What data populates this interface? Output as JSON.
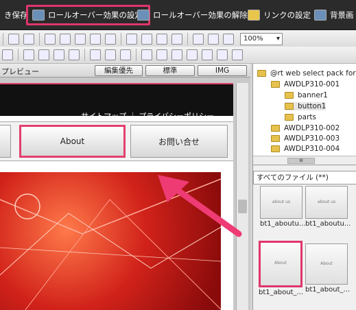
{
  "ribbon": {
    "partial_label": "き保存",
    "set_rollover": "ロールオーバー効果の設定",
    "remove_rollover": "ロールオーバー効果の解除",
    "link_settings": "リンクの設定",
    "background": "背景画"
  },
  "toolbar": {
    "zoom": "100%"
  },
  "preview": {
    "label": "プレビュー",
    "mode": "編集優先",
    "style": "標準",
    "img": "IMG"
  },
  "page": {
    "util_links": "サイトマップ ｜ プライバシーポリシー",
    "nav_about": "About",
    "nav_contact": "お問い合せ"
  },
  "tree": {
    "root": "@rt web select pack for H",
    "items": [
      "AWDLP310-001",
      "banner1",
      "button1",
      "parts",
      "AWDLP310-002",
      "AWDLP310-003",
      "AWDLP310-004"
    ],
    "scroll_mark": "III"
  },
  "files": {
    "filter": "すべてのファイル (**)",
    "thumbs": [
      "bt1_aboutu...",
      "bt1_aboutu...",
      "bt1_about_...",
      "bt1_about_..."
    ],
    "thumb_text": [
      "about us",
      "about us",
      "About",
      "About"
    ]
  },
  "colors": {
    "highlight": "#e0356b",
    "ribbon_bg": "#2b2b2b"
  }
}
